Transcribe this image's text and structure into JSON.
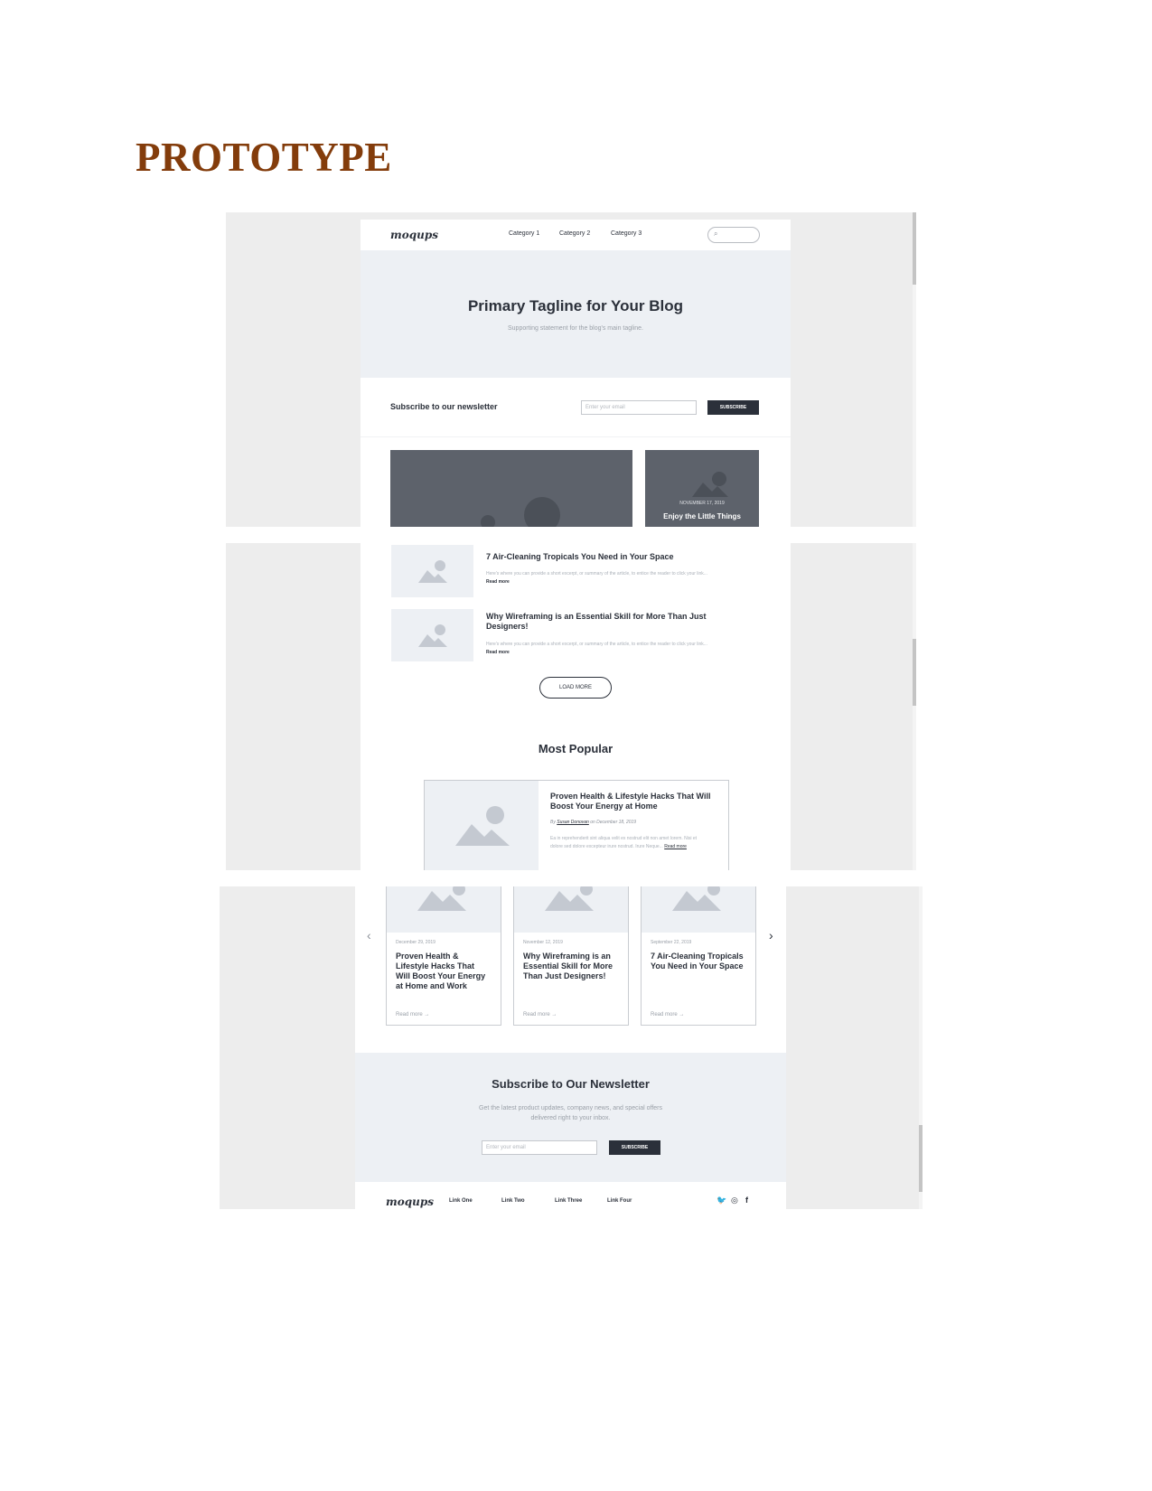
{
  "document": {
    "heading": "PROTOTYPE"
  },
  "site": {
    "logo": "moqups",
    "nav": [
      "Category 1",
      "Category 2",
      "Category 3"
    ],
    "search_placeholder": ""
  },
  "hero": {
    "tagline": "Primary Tagline for Your Blog",
    "supporting": "Supporting statement for the blog's main tagline."
  },
  "newsletter_bar": {
    "label": "Subscribe to our newsletter",
    "placeholder": "Enter your email",
    "button": "SUBSCRIBE"
  },
  "featured": {
    "side_date": "NOVEMBER 17, 2019",
    "side_title": "Enjoy the Little Things"
  },
  "articles": [
    {
      "title": "7 Air-Cleaning Tropicals You Need in Your Space",
      "excerpt": "Here's where you can provide a short excerpt, or summary of the article, to entice the reader to click your link...",
      "read_more": "Read more"
    },
    {
      "title": "Why Wireframing is an Essential Skill for More Than Just Designers!",
      "excerpt": "Here's where you can provide a short excerpt, or summary of the article, to entice the reader to click your link...",
      "read_more": "Read more"
    }
  ],
  "load_more": "LOAD MORE",
  "most_popular": {
    "heading": "Most Popular",
    "title": "Proven Health & Lifestyle Hacks That Will Boost Your Energy at Home",
    "meta_by": "By",
    "author": "Susan Donovan",
    "meta_date": "on December 18, 2019",
    "excerpt": "Ea in reprehenderit sint aliqua velit ex nostrud elit non amet lorem. Nisi et dolore sed dolore excepteur irure nostrud. Irure",
    "excerpt_end": "Neque...",
    "read_more": "Read more"
  },
  "carousel": [
    {
      "date": "December 29, 2019",
      "title": "Proven Health & Lifestyle Hacks That Will Boost Your Energy at Home and Work",
      "read": "Read more  →"
    },
    {
      "date": "November 12, 2019",
      "title": "Why Wireframing is an Essential Skill for More Than Just Designers!",
      "read": "Read more  →"
    },
    {
      "date": "September 22, 2019",
      "title": "7 Air-Cleaning Tropicals You Need in Your Space",
      "read": "Read more  →"
    }
  ],
  "carousel_nav": {
    "prev": "‹",
    "next": "›"
  },
  "newsletter_block": {
    "heading": "Subscribe to Our Newsletter",
    "line1": "Get the latest product updates, company news, and special offers",
    "line2": "delivered right to your inbox.",
    "placeholder": "Enter your email",
    "button": "SUBSCRIBE"
  },
  "footer": {
    "logo": "moqups",
    "links": [
      "Link One",
      "Link Two",
      "Link Three",
      "Link Four"
    ],
    "social_icons": [
      "twitter-icon",
      "instagram-icon",
      "facebook-icon"
    ]
  }
}
